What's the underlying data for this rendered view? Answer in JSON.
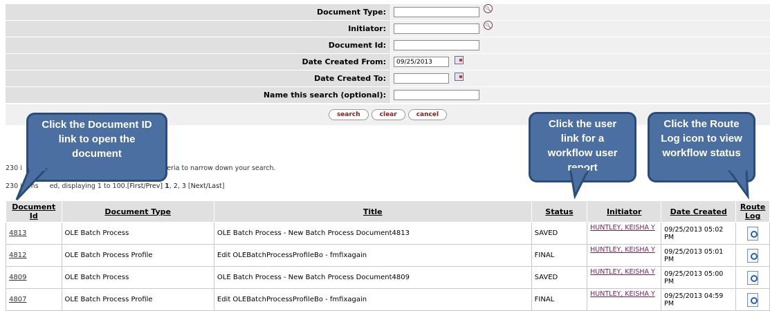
{
  "form": {
    "fields": [
      {
        "label": "Document Type:",
        "value": "",
        "extra": "lookup"
      },
      {
        "label": "Initiator:",
        "value": "",
        "extra": "lookup"
      },
      {
        "label": "Document Id:",
        "value": "",
        "extra": "none"
      },
      {
        "label": "Date Created From:",
        "value": "09/25/2013",
        "extra": "calendar"
      },
      {
        "label": "Date Created To:",
        "value": "",
        "extra": "calendar"
      },
      {
        "label": "Name this search (optional):",
        "value": "",
        "extra": "none"
      }
    ],
    "buttons": {
      "search": "search",
      "clear": "clear",
      "cancel": "cancel"
    }
  },
  "messages": {
    "count_prefix": "230 i",
    "count_suffix": "rch criteria to narrow down your search.",
    "paging_prefix": "230 items",
    "paging_mid": "ed, displaying 1 to 100.",
    "first_prev": "[First/Prev]",
    "page1": "1",
    "page2": "2",
    "page3": "3",
    "next_last": "[Next/Last]"
  },
  "table": {
    "headers": [
      "Document Id",
      "Document Type",
      "Title",
      "Status",
      "Initiator",
      "Date Created",
      "Route Log"
    ],
    "rows": [
      {
        "id": "4813",
        "type": "OLE Batch Process",
        "title": "OLE Batch Process - New Batch Process Document4813",
        "status": "SAVED",
        "initiator": "HUNTLEY, KEISHA Y",
        "date": "09/25/2013 05:02 PM"
      },
      {
        "id": "4812",
        "type": "OLE Batch Process Profile",
        "title": "Edit OLEBatchProcessProfileBo - fmfixagain",
        "status": "FINAL",
        "initiator": "HUNTLEY, KEISHA Y",
        "date": "09/25/2013 05:01 PM"
      },
      {
        "id": "4809",
        "type": "OLE Batch Process",
        "title": "OLE Batch Process - New Batch Process Document4809",
        "status": "SAVED",
        "initiator": "HUNTLEY, KEISHA Y",
        "date": "09/25/2013 05:00 PM"
      },
      {
        "id": "4807",
        "type": "OLE Batch Process Profile",
        "title": "Edit OLEBatchProcessProfileBo - fmfixagain",
        "status": "FINAL",
        "initiator": "HUNTLEY, KEISHA Y",
        "date": "09/25/2013 04:59 PM"
      }
    ]
  },
  "callouts": {
    "doc_id": "Click the Document ID link to open the document",
    "user": "Click the user link for a workflow user report",
    "route": "Click the Route Log icon to view workflow status"
  },
  "colors": {
    "callout_fill": "#4a6fa0",
    "callout_border": "#2c4c78",
    "header_bg": "#e0e0e0"
  }
}
